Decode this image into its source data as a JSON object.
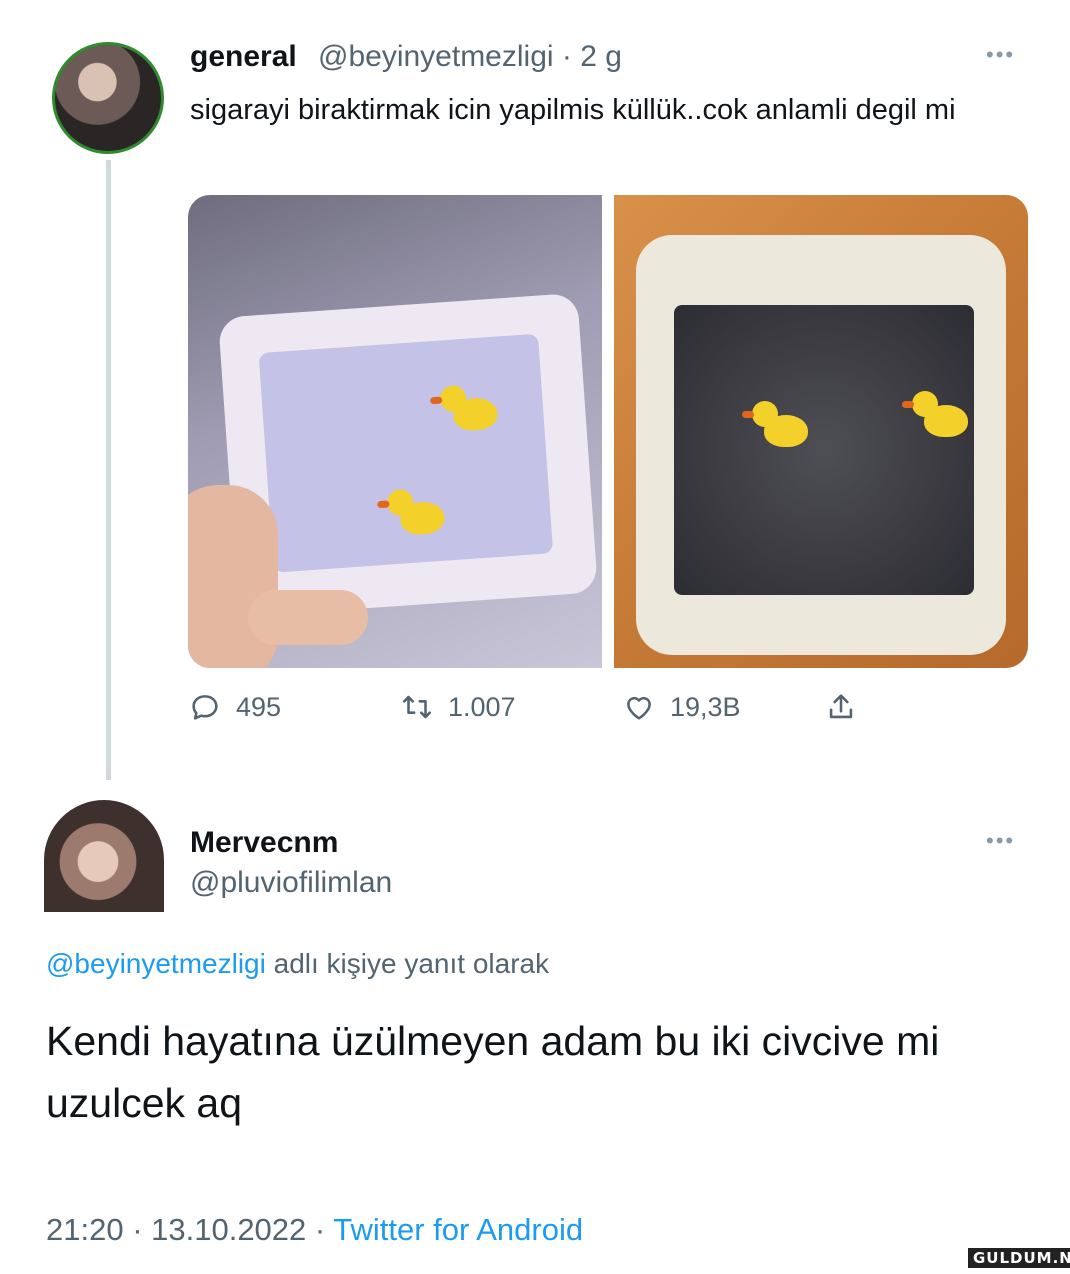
{
  "tweet": {
    "display_name": "general",
    "handle_time": "@beyinyetmezligi · 2 g",
    "more_icon": "more-horizontal-icon",
    "text": "sigarayi biraktirmak icin yapilmis küllük..cok anlamli degil mi",
    "stats": {
      "replies": "495",
      "retweets": "1.007",
      "likes": "19,3B"
    },
    "icons": [
      "reply-icon",
      "retweet-icon",
      "like-icon",
      "share-icon"
    ]
  },
  "reply": {
    "display_name": "Mervecnm",
    "handle": "@pluviofilimlan",
    "reply_to_mention": "@beyinyetmezligi",
    "reply_to_suffix": " adlı kişiye yanıt olarak",
    "text": "Kendi hayatına üzülmeyen adam bu iki civcive mi uzulcek aq",
    "time_date": "21:20 · 13.10.2022 · ",
    "source": "Twitter for Android"
  },
  "watermark": "GULDUM.NET",
  "colors": {
    "link": "#1d9bf0",
    "secondary_text": "#536471",
    "avatar_ring": "#2e8b2e"
  }
}
